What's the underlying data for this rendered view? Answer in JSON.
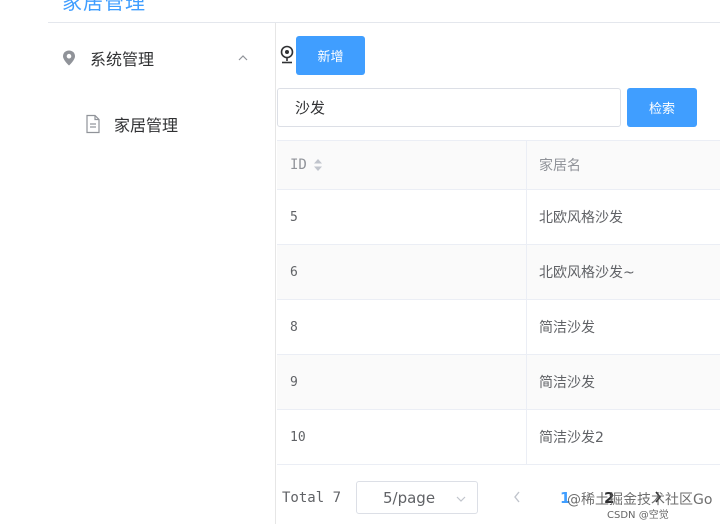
{
  "header": {
    "title": "家居管理"
  },
  "sidebar": {
    "menu": {
      "label": "系统管理"
    },
    "sub": {
      "label": "家居管理"
    }
  },
  "toolbar": {
    "add_label": "新增"
  },
  "search": {
    "value": "沙发",
    "button_label": "检索"
  },
  "table": {
    "headers": {
      "id": "ID",
      "name": "家居名"
    },
    "rows": [
      {
        "id": "5",
        "name": "北欧风格沙发"
      },
      {
        "id": "6",
        "name": "北欧风格沙发~"
      },
      {
        "id": "8",
        "name": "简洁沙发"
      },
      {
        "id": "9",
        "name": "简洁沙发"
      },
      {
        "id": "10",
        "name": "简洁沙发2"
      }
    ]
  },
  "pagination": {
    "total": "Total 7",
    "page_size": "5/page",
    "page1": "1",
    "page2": "2"
  },
  "watermark": {
    "text": "@稀土掘金技术社区Go",
    "csdn": "CSDN @空觉"
  },
  "colors": {
    "primary": "#409eff",
    "stripe": "#fafafa",
    "border": "#ebeef5"
  }
}
